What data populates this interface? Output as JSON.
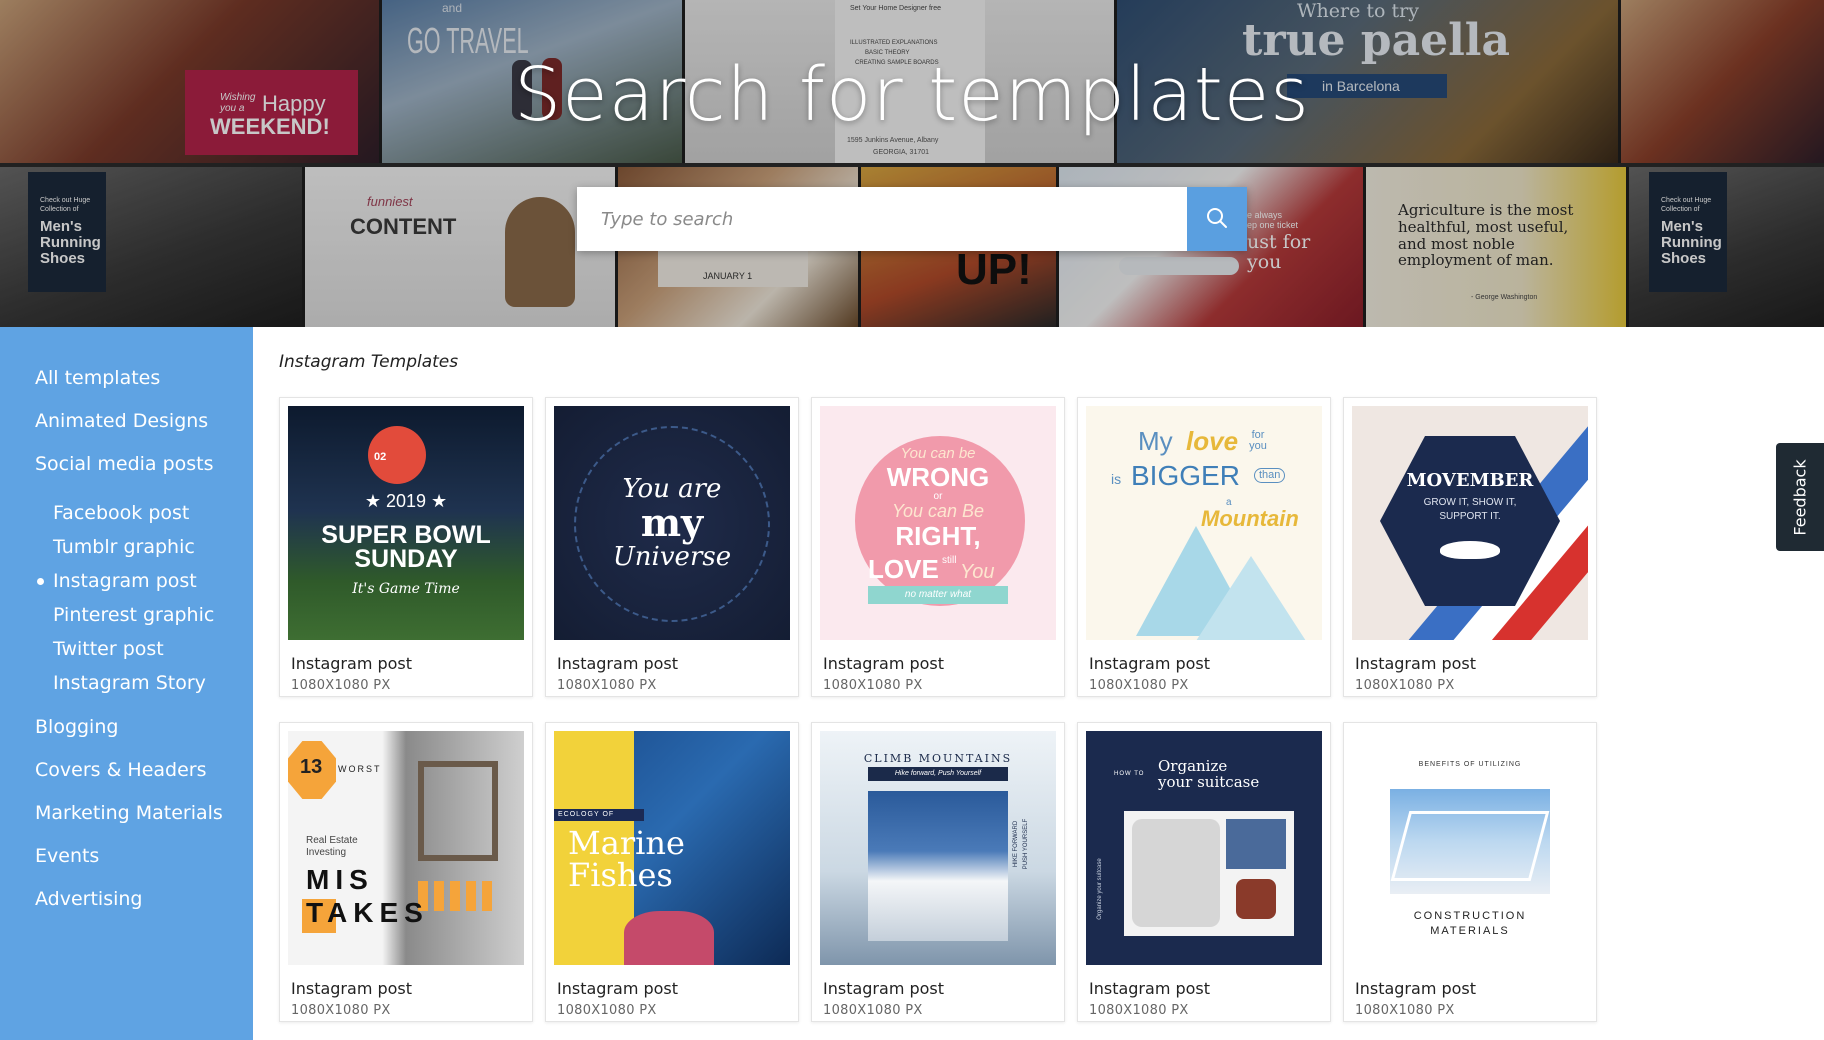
{
  "hero": {
    "title": "Search for templates",
    "search_placeholder": "Type to search",
    "tiles_top": [
      {
        "texts": [
          "Wishing",
          "you a",
          "Happy",
          "WEEKEND!"
        ]
      },
      {
        "texts": [
          "and",
          "GO TRAVEL"
        ]
      },
      {
        "texts": [
          "Set Your Home Designer free",
          "ILLUSTRATED EXPLANATIONS",
          "BASIC THEORY",
          "CREATING SAMPLE BOARDS",
          "1595 Junkins Avenue, Albany",
          "GEORGIA, 31701"
        ]
      },
      {
        "texts": [
          "Where to try",
          "true paella",
          "in Barcelona"
        ]
      },
      {
        "texts": []
      }
    ],
    "tiles_bottom": [
      {
        "texts": [
          "Check out Huge",
          "Collection of",
          "Men's",
          "Running",
          "Shoes"
        ]
      },
      {
        "texts": [
          "funniest",
          "CONTENT"
        ]
      },
      {
        "texts": [
          "JANUARY 1"
        ]
      },
      {
        "texts": [
          "UP!"
        ]
      },
      {
        "texts": [
          "e always",
          "ep one ticket",
          "ust for",
          "you"
        ]
      },
      {
        "texts": [
          "Agriculture is the most healthful, most useful, and most noble employment of man.",
          "- George Washington"
        ]
      },
      {
        "texts": [
          "Check out Huge",
          "Collection of",
          "Men's",
          "Running",
          "Shoes"
        ]
      }
    ]
  },
  "sidebar": {
    "items_top": [
      "All templates",
      "Animated Designs",
      "Social media posts"
    ],
    "subitems": [
      "Facebook post",
      "Tumblr graphic",
      "Instagram post",
      "Pinterest graphic",
      "Twitter post",
      "Instagram Story"
    ],
    "active_subitem": "Instagram post",
    "items_bottom": [
      "Blogging",
      "Covers & Headers",
      "Marketing Materials",
      "Events",
      "Advertising"
    ]
  },
  "main": {
    "section_title": "Instagram Templates",
    "cards": [
      {
        "title": "Instagram post",
        "size": "1080X1080 PX",
        "art": [
          "02",
          "★ 2019 ★",
          "SUPER BOWL",
          "SUNDAY",
          "It's Game Time"
        ]
      },
      {
        "title": "Instagram post",
        "size": "1080X1080 PX",
        "art": [
          "You are",
          "my",
          "Universe"
        ]
      },
      {
        "title": "Instagram post",
        "size": "1080X1080 PX",
        "art": [
          "You can be",
          "WRONG",
          "or",
          "You can Be",
          "RIGHT,",
          "LOVE",
          "still",
          "You",
          "no matter what"
        ]
      },
      {
        "title": "Instagram post",
        "size": "1080X1080 PX",
        "art": [
          "My",
          "love",
          "for you",
          "is",
          "BIGGER",
          "than",
          "a",
          "Mountain"
        ]
      },
      {
        "title": "Instagram post",
        "size": "1080X1080 PX",
        "art": [
          "MOVEMBER",
          "GROW IT, SHOW IT,",
          "SUPPORT IT."
        ]
      },
      {
        "title": "Instagram post",
        "size": "1080X1080 PX",
        "art": [
          "13",
          "WORST",
          "Real Estate",
          "Investing",
          "MIS",
          "TAKES"
        ]
      },
      {
        "title": "Instagram post",
        "size": "1080X1080 PX",
        "art": [
          "ECOLOGY OF",
          "Marine",
          "Fishes"
        ]
      },
      {
        "title": "Instagram post",
        "size": "1080X1080 PX",
        "art": [
          "CLIMB MOUNTAINS",
          "Hike forward, Push Yourself",
          "HIKE FORWARD",
          "PUSH YOURSELF"
        ]
      },
      {
        "title": "Instagram post",
        "size": "1080X1080 PX",
        "art": [
          "HOW TO",
          "Organize",
          "your suitcase",
          "Organize your suitcase"
        ]
      },
      {
        "title": "Instagram post",
        "size": "1080X1080 PX",
        "art": [
          "BENEFITS OF UTILIZING",
          "CONSTRUCTION",
          "MATERIALS"
        ]
      }
    ]
  },
  "feedback_label": "Feedback",
  "colors": {
    "sidebar_bg": "#5fa3e3",
    "search_button": "#5a9fe0",
    "feedback_bg": "#1f2a33"
  }
}
